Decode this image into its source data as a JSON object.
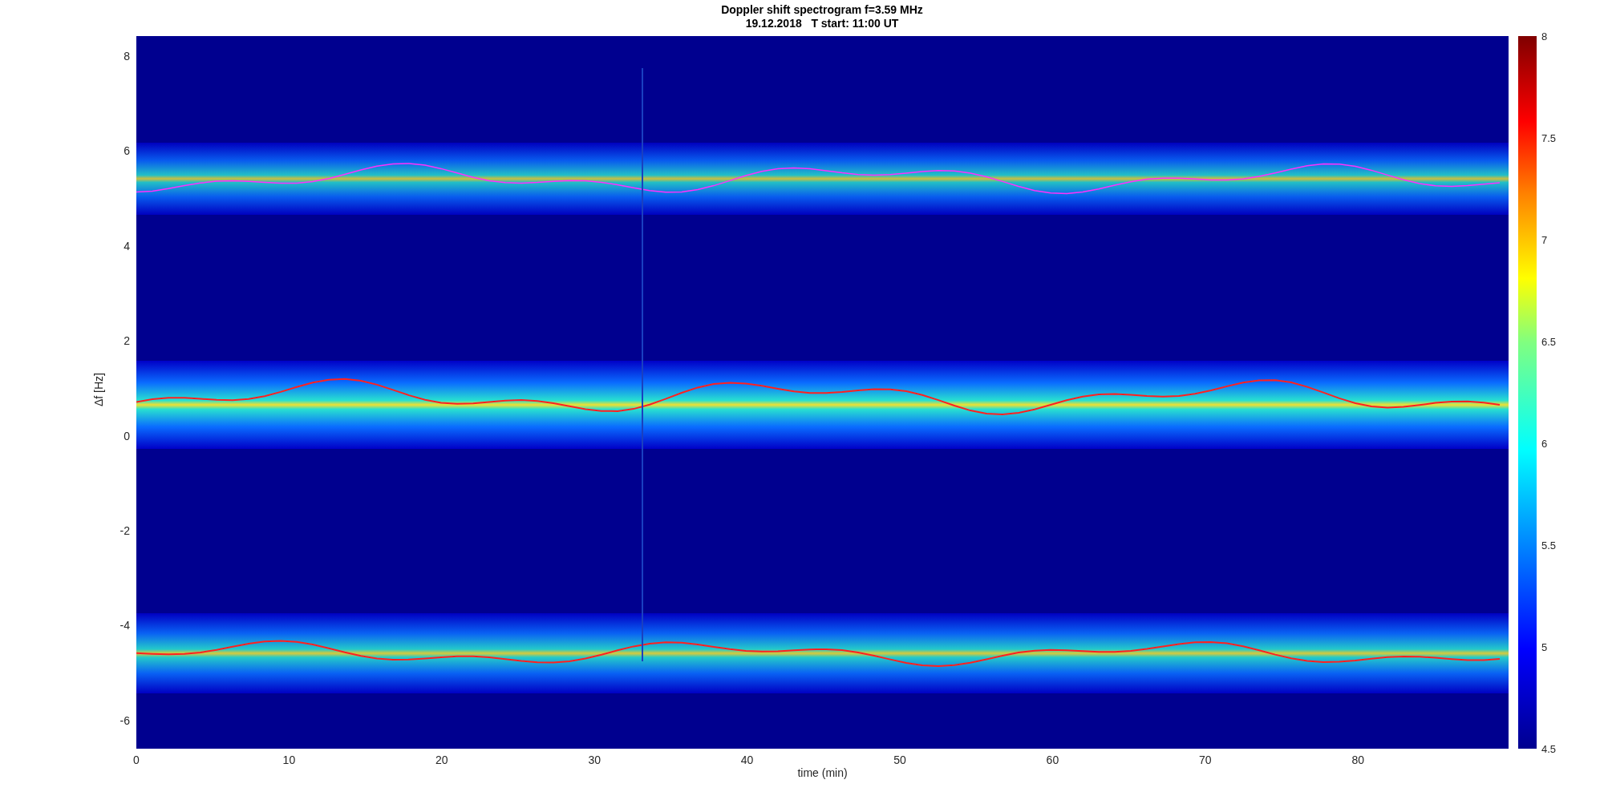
{
  "figure": {
    "title_lines": [
      "Doppler shift spectrogram f=3.59 MHz",
      "19.12.2018   T start: 11:00 UT"
    ],
    "ylabel": "Δf [Hz]",
    "xlabel": "time (min)",
    "yticks": [
      "8",
      "6",
      "4",
      "2",
      "0",
      "-2",
      "-4",
      "-6"
    ],
    "xticks": [
      "0",
      "10",
      "20",
      "30",
      "40",
      "50",
      "60",
      "70",
      "80"
    ],
    "colorbar_ticks": [
      "8",
      "7.5",
      "7",
      "6.5",
      "6",
      "5.5",
      "5",
      "4.5"
    ]
  }
}
